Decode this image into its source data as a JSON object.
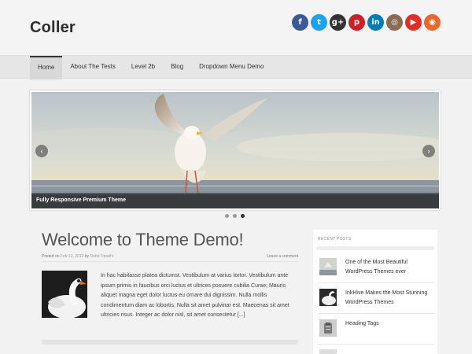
{
  "header": {
    "logo": "Coller"
  },
  "social": [
    {
      "icon": "facebook-icon",
      "glyph": "f",
      "color": "#3b5998"
    },
    {
      "icon": "twitter-icon",
      "glyph": "t",
      "color": "#1da1f2"
    },
    {
      "icon": "google-plus-icon",
      "glyph": "g+",
      "color": "#333333"
    },
    {
      "icon": "pinterest-icon",
      "glyph": "p",
      "color": "#cb2027"
    },
    {
      "icon": "linkedin-icon",
      "glyph": "in",
      "color": "#007bb6"
    },
    {
      "icon": "instagram-icon",
      "glyph": "◎",
      "color": "#8a6a55"
    },
    {
      "icon": "youtube-icon",
      "glyph": "▶",
      "color": "#e52d27"
    },
    {
      "icon": "rss-icon",
      "glyph": "◉",
      "color": "#e8692c"
    }
  ],
  "nav": {
    "items": [
      {
        "label": "Home",
        "active": true
      },
      {
        "label": "About The Tests",
        "active": false
      },
      {
        "label": "Level 2b",
        "active": false
      },
      {
        "label": "Blog",
        "active": false
      },
      {
        "label": "Dropdown Menu Demo",
        "active": false
      }
    ]
  },
  "slider": {
    "caption": "Fully Responsive Premium Theme",
    "prev_glyph": "‹",
    "next_glyph": "›",
    "dots": [
      false,
      false,
      true
    ]
  },
  "post": {
    "title": "Welcome to Theme Demo!",
    "posted_on": "Posted on",
    "date": "Feb 13, 2012",
    "by": "by",
    "author": "Rohit Tripathi",
    "comment": "Leave a comment",
    "excerpt": "In hac habitasse platea dictumst. Vestibulum at varius tortor. Vestibulum ante ipsum primis in faucibus orci luctus et ultrices posuere cubilia Curae; Mauris aliquet magna eget dolor luctus eu ornare dui dignissim. Nulla mollis condimentum diam ac lobortis. Nulla sit amet pulvinar est. Maecenas sit amet ultricies risus. Integer ac dolor nisl, sit amet consectetur [...]"
  },
  "sidebar": {
    "widget_title": "RECENT POSTS",
    "recent_posts": [
      {
        "title": "One of the Most Beautiful WordPress Themes ever"
      },
      {
        "title": "InkHive Makes the Most Stunning WordPress Themes"
      },
      {
        "title": "Heading Tags"
      }
    ]
  }
}
